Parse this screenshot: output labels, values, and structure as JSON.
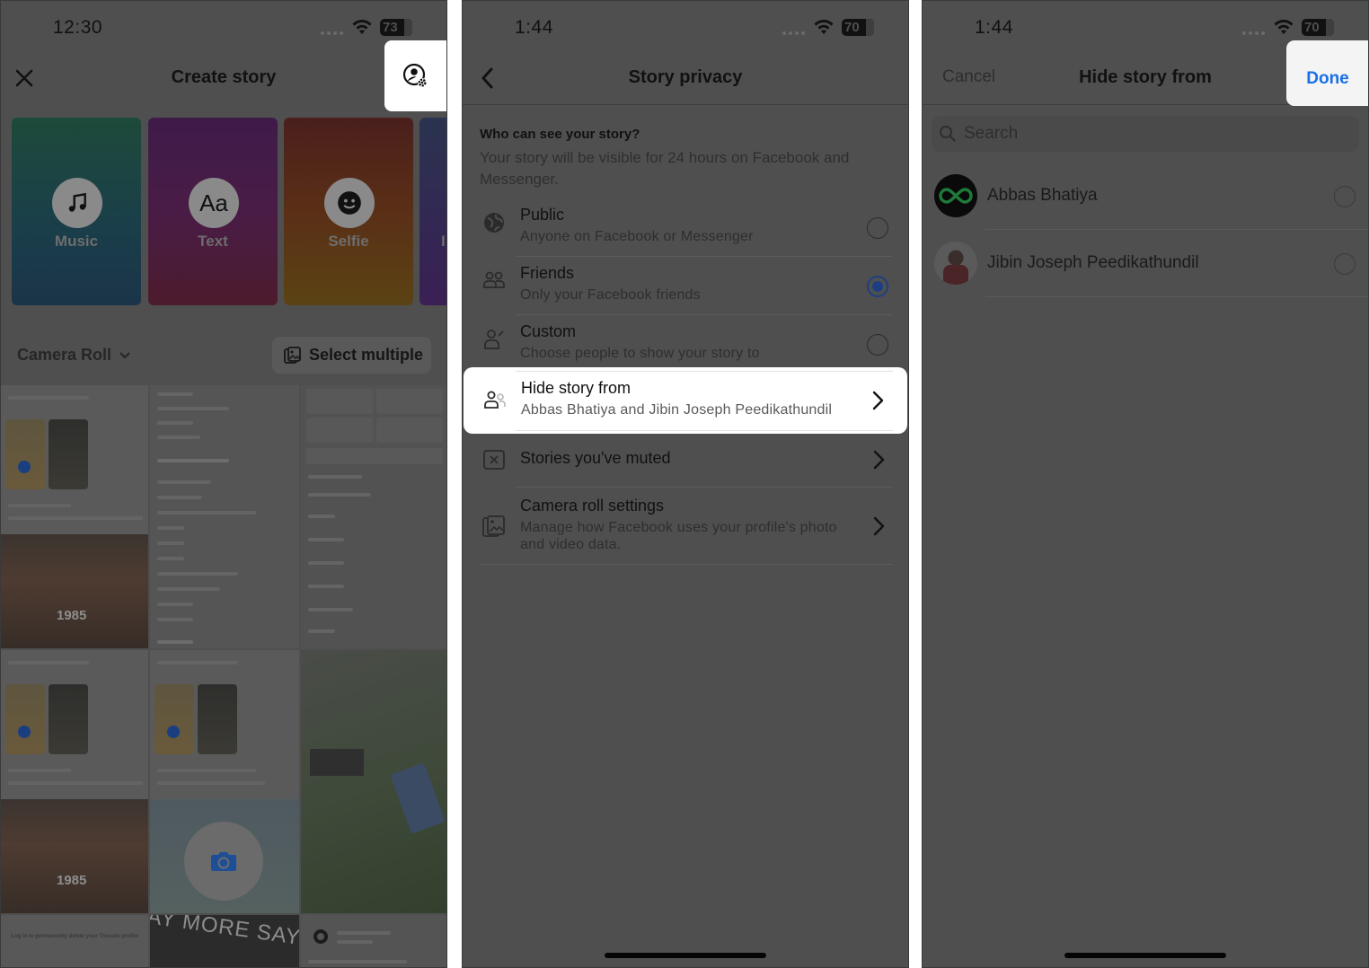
{
  "panels": {
    "create_story": {
      "status": {
        "time": "12:30",
        "battery": "73"
      },
      "nav": {
        "title": "Create story",
        "close_icon": "close-icon",
        "privacy_icon": "story-privacy-settings-icon"
      },
      "cards": [
        {
          "label": "Music",
          "icon": "music-note-icon"
        },
        {
          "label": "Text",
          "icon": "text-aa-icon",
          "glyph": "Aa"
        },
        {
          "label": "Selfie",
          "icon": "smiley-icon"
        },
        {
          "label": "I",
          "icon": ""
        }
      ],
      "camera_roll_label": "Camera Roll",
      "select_multiple_label": "Select multiple",
      "thumbnails": {
        "rambo_year": "1985",
        "say_more": "AY MORE  SAY M",
        "threads_text": "Log in to permanently delete your Threads profile"
      }
    },
    "story_privacy": {
      "status": {
        "time": "1:44",
        "battery": "70"
      },
      "nav": {
        "title": "Story privacy"
      },
      "question": "Who can see your story?",
      "description": "Your story will be visible for 24 hours on Facebook and Messenger.",
      "options": [
        {
          "title": "Public",
          "subtitle": "Anyone on Facebook or Messenger",
          "icon": "globe-icon",
          "selected": false
        },
        {
          "title": "Friends",
          "subtitle": "Only your Facebook friends",
          "icon": "friends-icon",
          "selected": true
        },
        {
          "title": "Custom",
          "subtitle": "Choose people to show your story to",
          "icon": "custom-people-icon",
          "selected": false
        }
      ],
      "links": [
        {
          "title": "Hide story from",
          "subtitle": "Abbas Bhatiya and Jibin Joseph Peedikathundil",
          "icon": "hide-people-icon",
          "highlighted": true
        },
        {
          "title": "Stories you've muted",
          "subtitle": "",
          "icon": "muted-box-icon"
        },
        {
          "title": "Camera roll settings",
          "subtitle": "Manage how Facebook uses your profile's photo and video data.",
          "icon": "camera-roll-icon"
        }
      ]
    },
    "hide_story_from": {
      "status": {
        "time": "1:44",
        "battery": "70"
      },
      "nav": {
        "title": "Hide story from",
        "cancel_label": "Cancel",
        "done_label": "Done"
      },
      "search_placeholder": "Search",
      "people": [
        {
          "name": "Abbas Bhatiya",
          "selected": false
        },
        {
          "name": "Jibin Joseph Peedikathundil",
          "selected": false
        }
      ]
    }
  },
  "colors": {
    "accent_blue": "#1b6fe6",
    "radio_selected": "#1c3f84",
    "dim_overlay": "#4f4f4f",
    "highlight": "#ffffff"
  }
}
